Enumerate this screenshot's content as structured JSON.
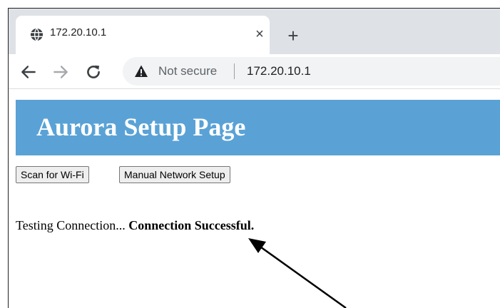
{
  "browser": {
    "tab": {
      "title": "172.20.10.1",
      "close_glyph": "×",
      "favicon": "globe-icon"
    },
    "new_tab_glyph": "+",
    "nav": {
      "back_icon": "back-arrow-icon",
      "forward_icon": "forward-arrow-icon",
      "reload_icon": "reload-icon"
    },
    "omnibox": {
      "security_icon": "warning-triangle-icon",
      "security_label": "Not secure",
      "url": "172.20.10.1"
    }
  },
  "page": {
    "title": "Aurora Setup Page",
    "header_color": "#5aa2d6",
    "buttons": {
      "scan": "Scan for Wi-Fi",
      "manual": "Manual Network Setup"
    },
    "status": {
      "prefix": "Testing Connection...",
      "result": "Connection Successful."
    }
  },
  "annotation": {
    "type": "arrow",
    "color": "#000000"
  }
}
